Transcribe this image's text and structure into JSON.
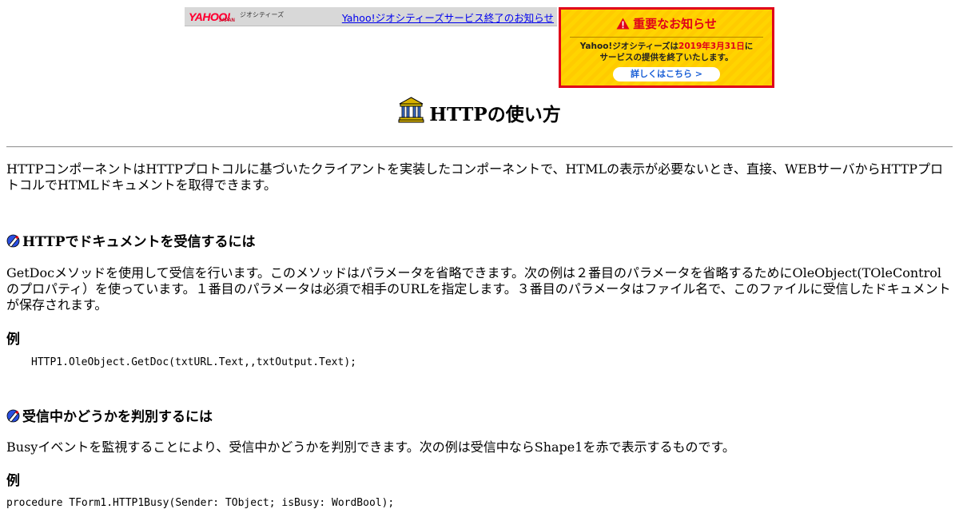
{
  "yahoo_bar": {
    "logo_text": "YAHOO!",
    "logo_sub": "JAPAN",
    "service_name": "ジオシティーズ",
    "link_text": "Yahoo!ジオシティーズサービス終了のお知らせ"
  },
  "notice": {
    "title": "重要なお知らせ",
    "body_pre": "Yahoo!ジオシティーズは",
    "body_date": "2019年3月31日",
    "body_post": "に",
    "body_line2": "サービスの提供を終了いたします。",
    "button_label": "詳しくはこちら >"
  },
  "page": {
    "title": "HTTPの使い方",
    "intro": "HTTPコンポーネントはHTTPプロトコルに基づいたクライアントを実装したコンポーネントで、HTMLの表示が必要ないとき、直接、WEBサーバからHTTPプロトコルでHTMLドキュメントを取得できます。",
    "section1": {
      "heading": "HTTPでドキュメントを受信するには",
      "text": "GetDocメソッドを使用して受信を行います。このメソッドはパラメータを省略できます。次の例は２番目のパラメータを省略するためにOleObject(TOleControlのプロパティ）を使っています。１番目のパラメータは必須で相手のURLを指定します。３番目のパラメータはファイル名で、このファイルに受信したドキュメントが保存されます。",
      "example_label": "例",
      "code": "HTTP1.OleObject.GetDoc(txtURL.Text,,txtOutput.Text);"
    },
    "section2": {
      "heading": "受信中かどうかを判別するには",
      "text": "Busyイベントを監視することにより、受信中かどうかを判別できます。次の例は受信中ならShape1を赤で表示するものです。",
      "example_label": "例",
      "code": "procedure TForm1.HTTP1Busy(Sender: TObject; isBusy: WordBool);"
    }
  },
  "colors": {
    "notice_red": "#e0001a",
    "notice_yellow": "#ffd400",
    "link": "#0000ee"
  }
}
